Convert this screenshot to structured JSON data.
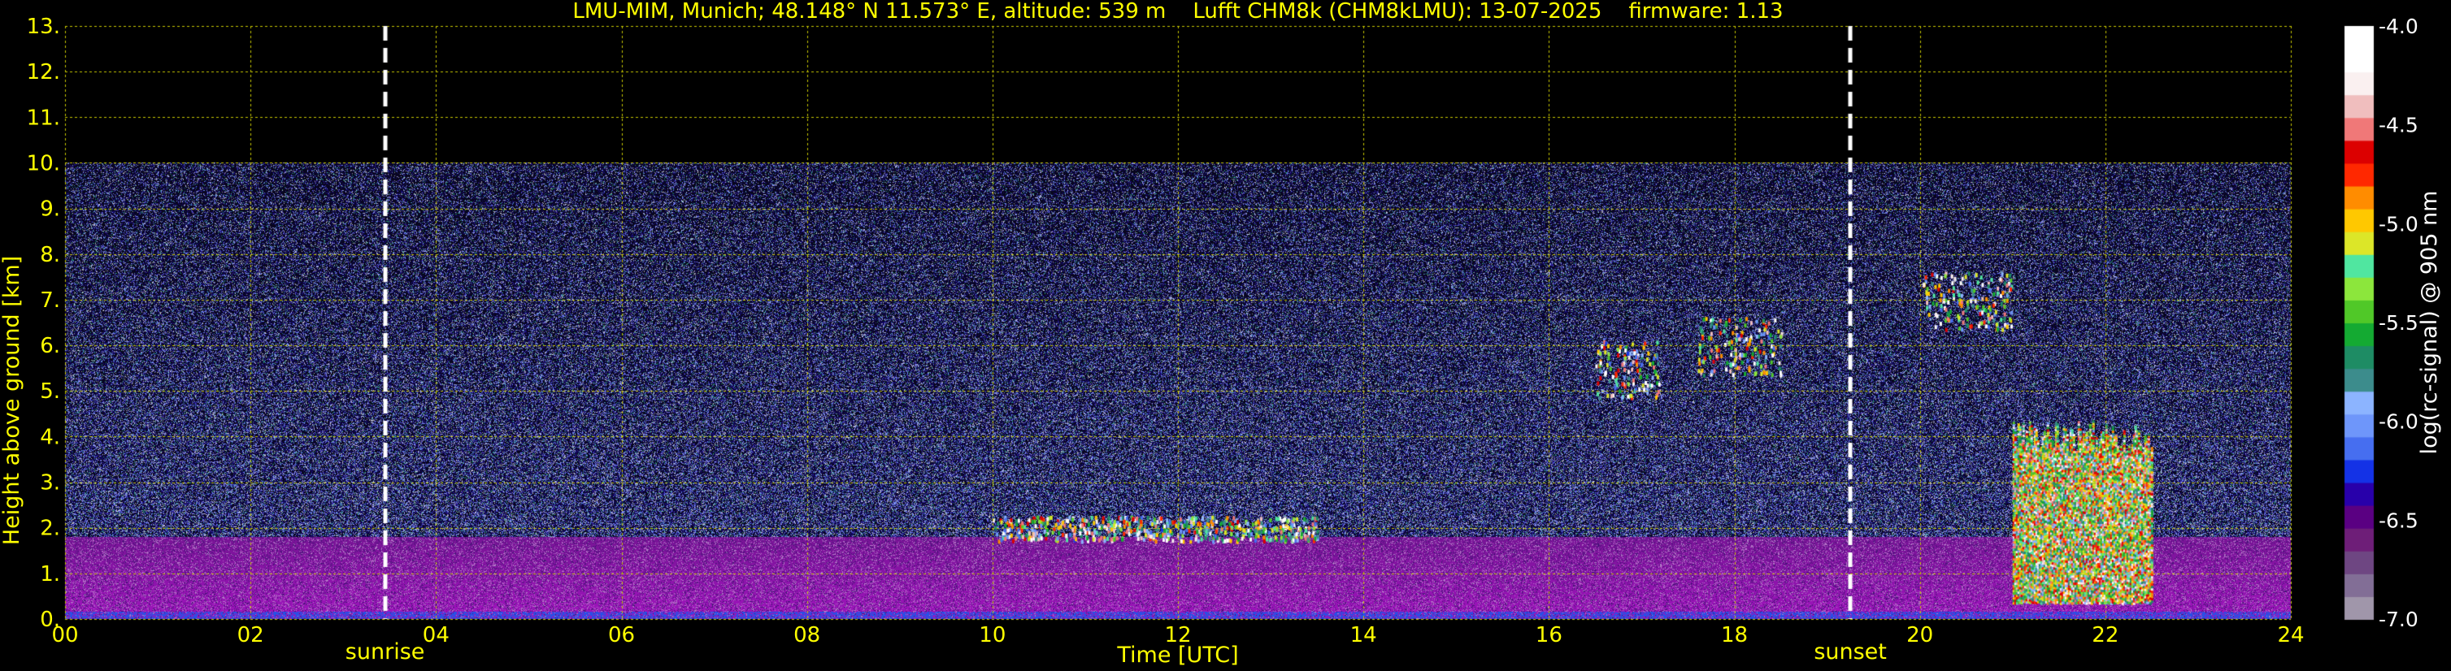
{
  "header": {
    "title": "LMU-MIM, Munich; 48.148° N 11.573° E, altitude: 539 m    Lufft CHM8k (CHM8kLMU): 13-07-2025    firmware: 1.13"
  },
  "colors": {
    "background": "#000000",
    "text": "#ffff00",
    "grid": "#c8c800",
    "marker_line": "#ffffff",
    "colorbar_text": "#ffffff"
  },
  "chart_data": {
    "type": "heatmap",
    "title": "LMU-MIM, Munich; 48.148° N 11.573° E, altitude: 539 m    Lufft CHM8k (CHM8kLMU): 13-07-2025    firmware: 1.13",
    "xlabel": "Time [UTC]",
    "ylabel": "Height above ground [km]",
    "xlim": [
      0,
      24
    ],
    "ylim": [
      0,
      13
    ],
    "x_ticks": [
      0,
      2,
      4,
      6,
      8,
      10,
      12,
      14,
      16,
      18,
      20,
      22,
      24
    ],
    "x_tick_labels": [
      "00",
      "02",
      "04",
      "06",
      "08",
      "10",
      "12",
      "14",
      "16",
      "18",
      "20",
      "22",
      "24"
    ],
    "y_ticks": [
      0,
      1,
      2,
      3,
      4,
      5,
      6,
      7,
      8,
      9,
      10,
      11,
      12,
      13
    ],
    "y_tick_labels": [
      "0.",
      "1.",
      "2.",
      "3.",
      "4.",
      "5.",
      "6.",
      "7.",
      "8.",
      "9.",
      "10.",
      "11.",
      "12.",
      "13."
    ],
    "grid": true,
    "data_max_height_km": 10,
    "markers": [
      {
        "label": "sunrise",
        "time_utc": 3.45
      },
      {
        "label": "sunset",
        "time_utc": 19.25
      }
    ],
    "colorbar": {
      "label": "log(rc-signal) @ 905 nm",
      "range": [
        -7.0,
        -4.0
      ],
      "ticks": [
        -7.0,
        -6.5,
        -6.0,
        -5.5,
        -5.0,
        -4.5,
        -4.0
      ],
      "tick_labels": [
        "-7.0",
        "-6.5",
        "-6.0",
        "-5.5",
        "-5.0",
        "-4.5",
        "-4.0"
      ]
    },
    "features": [
      {
        "kind": "aerosol_layer",
        "time_start": 0,
        "time_end": 24,
        "height_top_km": 1.8
      },
      {
        "kind": "cloud",
        "time_start": 10.0,
        "time_end": 13.5,
        "height_km": 2.0
      },
      {
        "kind": "cloud",
        "time_start": 16.5,
        "time_end": 17.2,
        "height_km": 5.5
      },
      {
        "kind": "cloud",
        "time_start": 17.6,
        "time_end": 18.5,
        "height_km": 6.0
      },
      {
        "kind": "cloud",
        "time_start": 20.0,
        "time_end": 21.0,
        "height_km": 7.0
      },
      {
        "kind": "precipitation",
        "time_start": 21.0,
        "time_end": 22.5,
        "height_km": 4.0
      }
    ]
  }
}
